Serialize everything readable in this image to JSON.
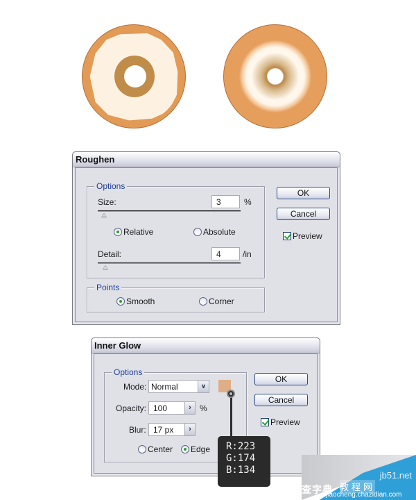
{
  "illustration": {
    "donut_left": "donut-roughened-icing",
    "donut_right": "donut-inner-glow-icing"
  },
  "roughen": {
    "title": "Roughen",
    "options_group": "Options",
    "size_label": "Size:",
    "size_value": "3",
    "size_unit": "%",
    "size_slider_fraction": 0.03,
    "relative_label": "Relative",
    "absolute_label": "Absolute",
    "relative_selected": true,
    "detail_label": "Detail:",
    "detail_value": "4",
    "detail_unit": "/in",
    "detail_slider_fraction": 0.04,
    "points_group": "Points",
    "smooth_label": "Smooth",
    "corner_label": "Corner",
    "smooth_selected": true,
    "ok_label": "OK",
    "cancel_label": "Cancel",
    "preview_label": "Preview",
    "preview_checked": true
  },
  "inner_glow": {
    "title": "Inner Glow",
    "options_group": "Options",
    "mode_label": "Mode:",
    "mode_value": "Normal",
    "opacity_label": "Opacity:",
    "opacity_value": "100",
    "opacity_unit": "%",
    "blur_label": "Blur:",
    "blur_value": "17 px",
    "center_label": "Center",
    "edge_label": "Edge",
    "edge_selected": true,
    "ok_label": "OK",
    "cancel_label": "Cancel",
    "preview_label": "Preview",
    "preview_checked": true,
    "color_hex": "#DFAE86"
  },
  "color_tooltip": {
    "r": "R:223",
    "g": "G:174",
    "b": "B:134"
  },
  "watermark": {
    "site": "jb51.net",
    "cn_left": "查字典",
    "cn_boxed": "教程网",
    "domain": "jiaocheng.chazidian.com"
  }
}
